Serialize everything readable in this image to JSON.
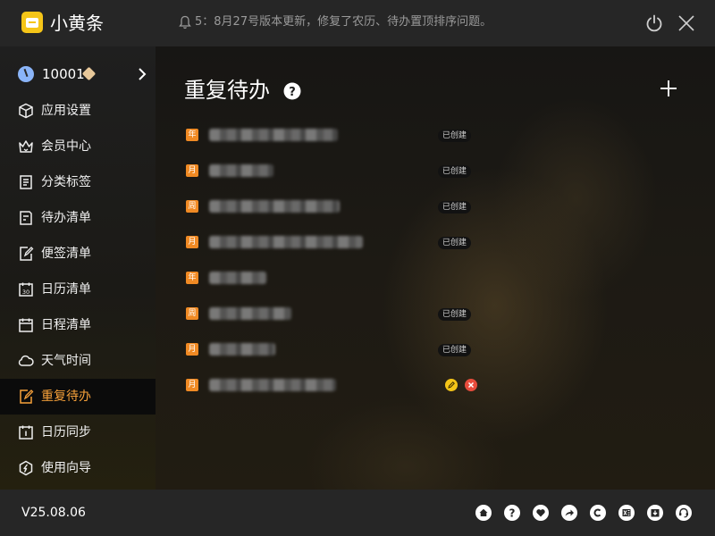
{
  "titlebar": {
    "app_name": "小黄条",
    "notice": "5：8月27号版本更新，修复了农历、待办置顶排序问题。",
    "icons": [
      "app-logo",
      "bell-icon",
      "power-icon",
      "close-icon"
    ]
  },
  "sidebar": {
    "user_id": "10001",
    "items": [
      {
        "label": "应用设置",
        "icon": "cube-icon"
      },
      {
        "label": "会员中心",
        "icon": "crown-icon"
      },
      {
        "label": "分类标签",
        "icon": "book-icon"
      },
      {
        "label": "待办清单",
        "icon": "checklist-icon"
      },
      {
        "label": "便签清单",
        "icon": "note-edit-icon"
      },
      {
        "label": "日历清单",
        "icon": "calendar-30-icon"
      },
      {
        "label": "日程清单",
        "icon": "calendar-icon"
      },
      {
        "label": "天气时间",
        "icon": "cloud-icon"
      },
      {
        "label": "重复待办",
        "icon": "repeat-note-icon",
        "active": true
      },
      {
        "label": "日历同步",
        "icon": "calendar-sync-icon"
      },
      {
        "label": "使用向导",
        "icon": "compass-icon"
      }
    ]
  },
  "main": {
    "title": "重复待办",
    "todos": [
      {
        "type": "年",
        "tag": "已创建"
      },
      {
        "type": "月",
        "tag": "已创建"
      },
      {
        "type": "周",
        "tag": "已创建"
      },
      {
        "type": "月",
        "tag": "已创建"
      },
      {
        "type": "年",
        "tag": ""
      },
      {
        "type": "周",
        "tag": "已创建"
      },
      {
        "type": "月",
        "tag": "已创建"
      },
      {
        "type": "月",
        "tag": ""
      }
    ]
  },
  "footer": {
    "version": "V25.08.06",
    "icons": [
      "home-icon",
      "help-icon",
      "heart-icon",
      "share-icon",
      "copyright-icon",
      "excel-export-icon",
      "download-icon",
      "support-icon"
    ]
  },
  "colors": {
    "accent": "#f7a13a",
    "badge": "#f08a24",
    "logo": "#f5c518",
    "delete": "#e74c3c",
    "edit": "#f5c518"
  }
}
